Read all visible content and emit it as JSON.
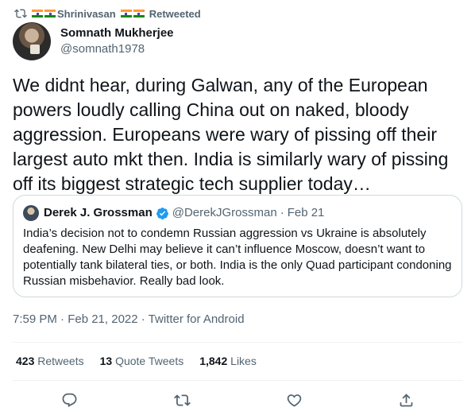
{
  "retweet": {
    "user_name": "Shrinivasan",
    "action_label": "Retweeted"
  },
  "author": {
    "display_name": "Somnath Mukherjee",
    "handle": "@somnath1978"
  },
  "tweet": {
    "text": "We didnt hear, during Galwan, any of the European powers loudly calling China out on naked, bloody aggression. Europeans were wary of pissing off their largest auto mkt then. India is similarly wary of pissing off its biggest strategic tech supplier today…"
  },
  "quoted_tweet": {
    "display_name": "Derek J. Grossman",
    "handle": "@DerekJGrossman",
    "separator": "·",
    "date": "Feb 21",
    "text": "India’s decision not to condemn Russian aggression vs Ukraine is absolutely deafening. New Delhi may believe it can’t influence Moscow, doesn’t want to potentially tank bilateral ties, or both. India is the only Quad participant condoning Russian misbehavior. Really bad look."
  },
  "meta": {
    "timestamp": "7:59 PM · Feb 21, 2022 · Twitter for Android"
  },
  "stats": [
    {
      "count": "423",
      "label": "Retweets"
    },
    {
      "count": "13",
      "label": "Quote Tweets"
    },
    {
      "count": "1,842",
      "label": "Likes"
    }
  ],
  "icons": {
    "retweet": "retweet-icon",
    "flag": "india-flag-icon",
    "verified": "verified-badge-icon",
    "reply": "reply-icon",
    "like": "heart-icon",
    "share": "share-icon"
  },
  "colors": {
    "text": "#0f1419",
    "secondary": "#536471",
    "verified": "#1d9bf0",
    "border": "#cfd9de",
    "divider": "#eff3f4"
  }
}
